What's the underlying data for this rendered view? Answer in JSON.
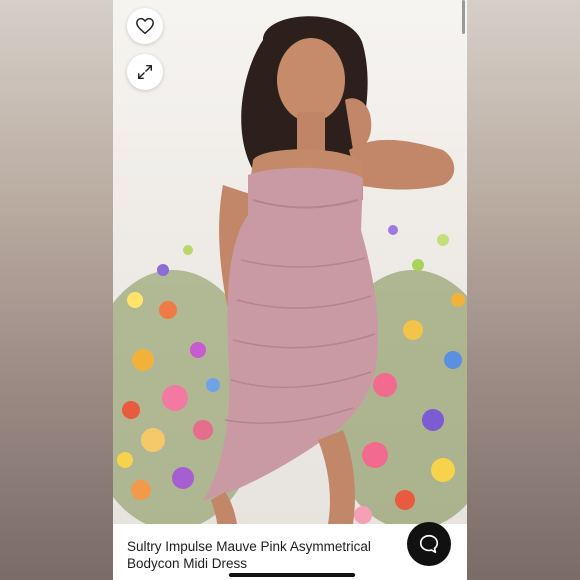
{
  "listing": {
    "title": "Sultry Impulse Mauve Pink Asymmetrical Bodycon Midi Dress"
  },
  "icons": {
    "favorite": "heart-icon",
    "expand": "expand-icon",
    "chat": "chat-bubble-icon"
  },
  "colors": {
    "dress": "#c99aa3",
    "chat_button": "#111111",
    "background": "#ffffff"
  }
}
